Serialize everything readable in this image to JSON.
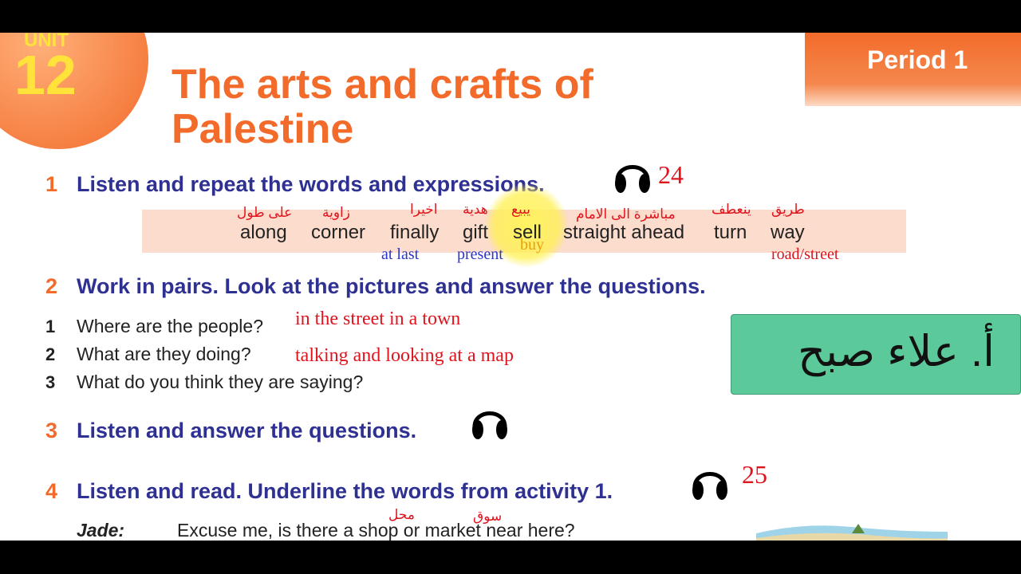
{
  "unit": {
    "label": "UNIT",
    "number": "12"
  },
  "title": "The arts and crafts of Palestine",
  "period": "Period 1",
  "exercises": [
    {
      "number": "1",
      "instruction": "Listen and repeat the words and expressions.",
      "page_note": "24"
    },
    {
      "number": "2",
      "instruction": "Work in pairs. Look at the pictures and answer the questions."
    },
    {
      "number": "3",
      "instruction": "Listen and answer the questions."
    },
    {
      "number": "4",
      "instruction": "Listen and read. Underline the words from activity 1.",
      "page_note": "25"
    }
  ],
  "vocabulary": [
    {
      "word": "along",
      "arabic": "على طول"
    },
    {
      "word": "corner",
      "arabic": "زاوية"
    },
    {
      "word": "finally",
      "arabic": "اخيرا",
      "synonym": "at last"
    },
    {
      "word": "gift",
      "arabic": "هدية",
      "synonym": "present"
    },
    {
      "word": "sell",
      "arabic": "يبيع",
      "synonym": "buy"
    },
    {
      "word": "straight ahead",
      "arabic": "مباشرة الى الامام"
    },
    {
      "word": "turn",
      "arabic": "ينعطف"
    },
    {
      "word": "way",
      "arabic": "طريق",
      "synonym": "road/street"
    }
  ],
  "questions": [
    {
      "number": "1",
      "text": "Where are the people?",
      "answer": "in the street in a town"
    },
    {
      "number": "2",
      "text": "What are they doing?",
      "answer": "talking and looking at a map"
    },
    {
      "number": "3",
      "text": "What do you think they are saying?"
    }
  ],
  "teacher_name": "أ. علاء صبح",
  "dialogue": {
    "speaker": "Jade:",
    "line": "Excuse me, is there a shop or market near here?",
    "notes": [
      "محل",
      "سوق"
    ]
  },
  "colors": {
    "orange": "#f26b2a",
    "navy": "#2e3192",
    "handwriting_red": "#e0141e",
    "handwriting_blue": "#2b35c8",
    "band": "#fcdccc",
    "name_box": "#5bc99a"
  }
}
